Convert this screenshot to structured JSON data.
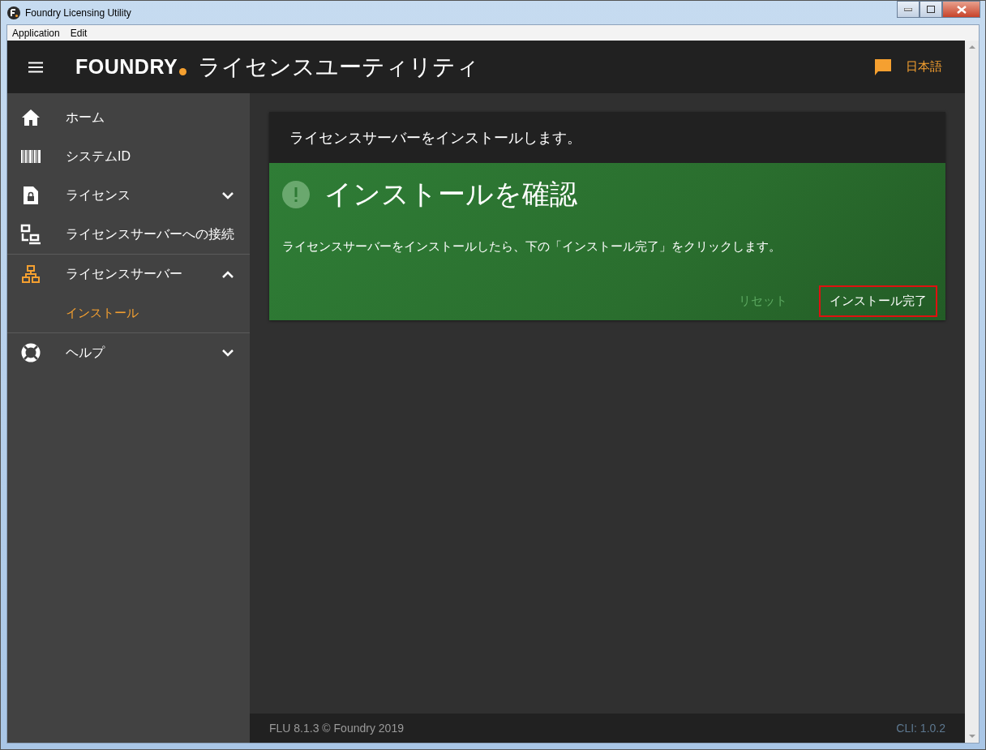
{
  "window": {
    "title": "Foundry Licensing Utility"
  },
  "menu": [
    "Application",
    "Edit"
  ],
  "header": {
    "brand": "FOUNDRY",
    "title": "ライセンスユーティリティ",
    "language": "日本語"
  },
  "sidebar": {
    "items": [
      {
        "label": "ホーム",
        "selected": false
      },
      {
        "label": "システムID",
        "selected": false
      },
      {
        "label": "ライセンス",
        "selected": false,
        "expanded": false
      },
      {
        "label": "ライセンスサーバーへの接続",
        "selected": false
      },
      {
        "label": "ライセンスサーバー",
        "selected": false,
        "expanded": true,
        "children": [
          {
            "label": "インストール",
            "selected": true
          }
        ]
      },
      {
        "label": "ヘルプ",
        "selected": false,
        "expanded": false
      }
    ]
  },
  "card": {
    "heading": "ライセンスサーバーをインストールします。",
    "title": "インストールを確認",
    "message": "ライセンスサーバーをインストールしたら、下の「インストール完了」をクリックします。",
    "buttons": [
      {
        "label": "リセット",
        "disabled": true,
        "highlighted": false
      },
      {
        "label": "インストール完了",
        "disabled": false,
        "highlighted": true
      }
    ]
  },
  "footer": {
    "version": "FLU 8.1.3 © Foundry 2019",
    "cli": "CLI: 1.0.2"
  }
}
